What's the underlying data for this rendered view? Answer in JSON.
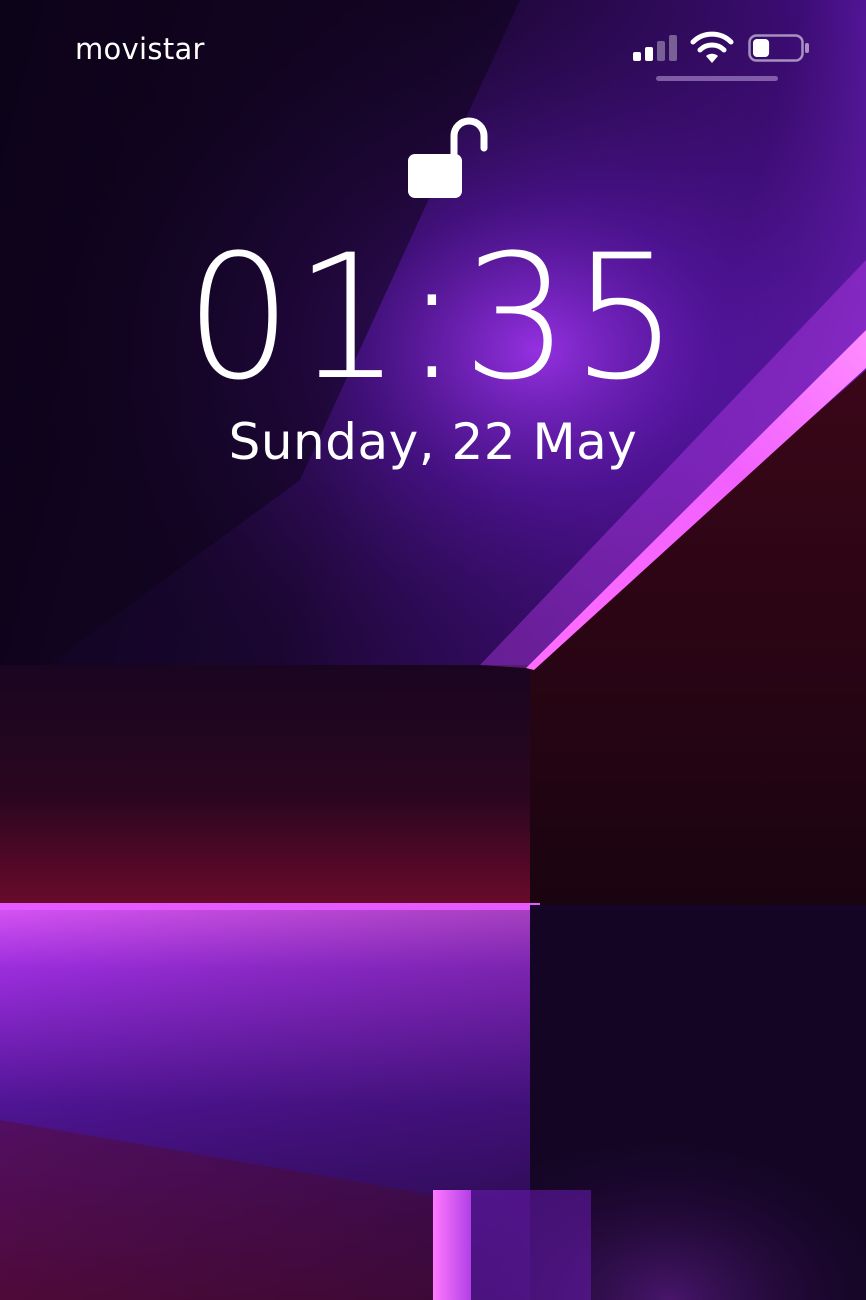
{
  "status_bar": {
    "carrier": "movistar",
    "signal_icon": "cellular-signal-icon",
    "wifi_icon": "wifi-icon",
    "battery_icon": "battery-icon",
    "battery_level": 0.35
  },
  "lock_screen": {
    "lock_icon": "unlocked-padlock-icon",
    "time": "01:35",
    "date": "Sunday, 22 May"
  },
  "colors": {
    "text": "#ffffff",
    "wallpaper_dark": "#0d0418",
    "wallpaper_purple": "#7a1fd0",
    "wallpaper_magenta": "#e85cff",
    "wallpaper_red": "#5a0a26"
  }
}
